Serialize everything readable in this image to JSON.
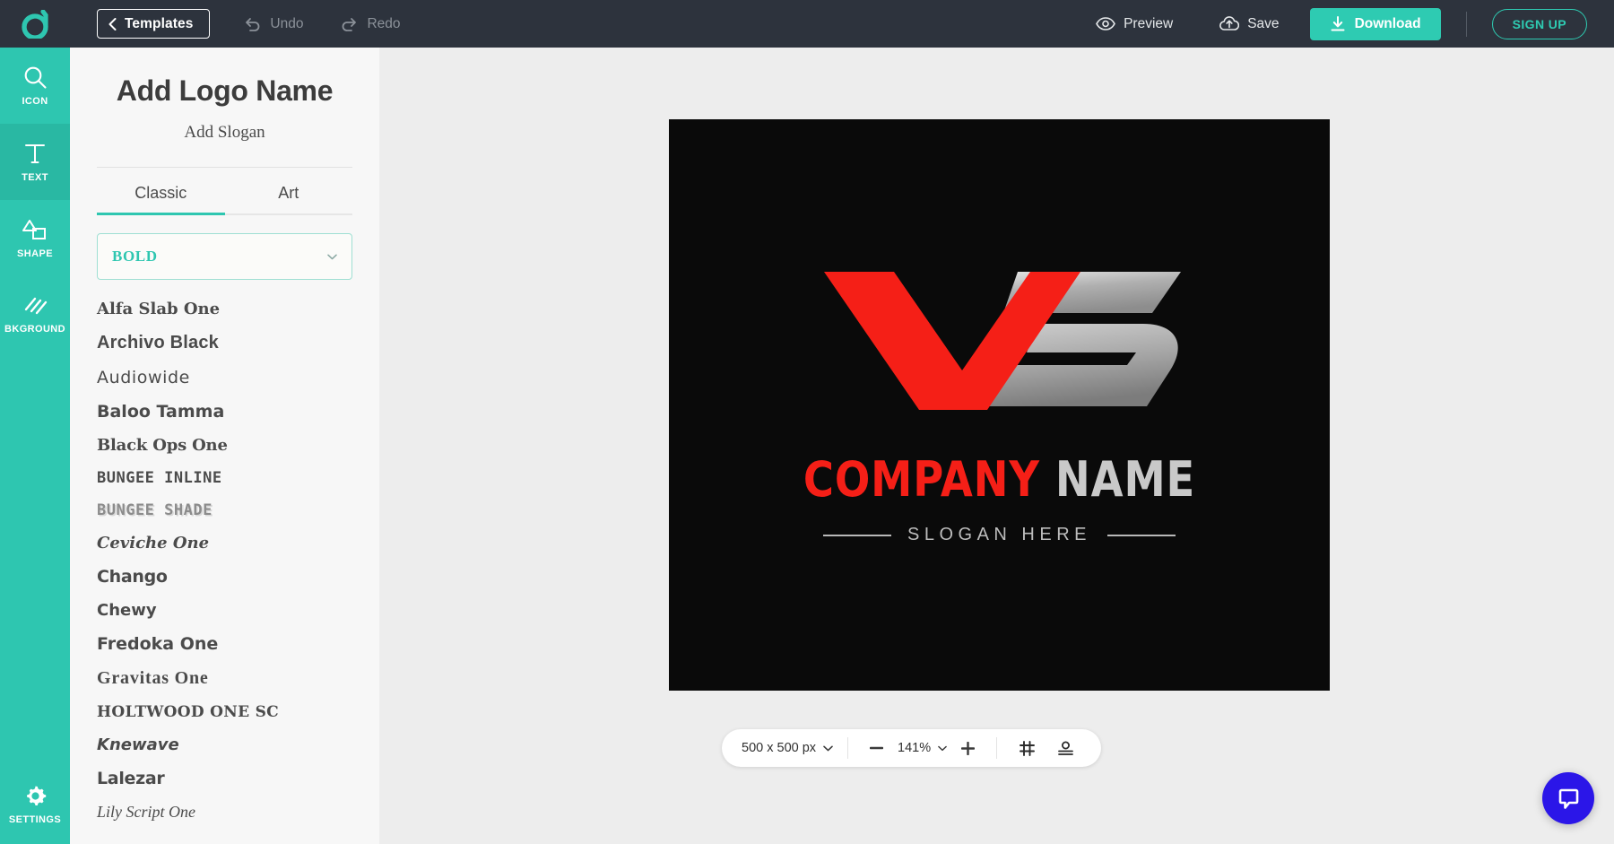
{
  "topbar": {
    "brand_icon": "designevo-logo-icon",
    "templates_label": "Templates",
    "back_icon": "chevron-left-icon",
    "undo_label": "Undo",
    "undo_icon": "undo-arrow-icon",
    "redo_label": "Redo",
    "redo_icon": "redo-arrow-icon",
    "preview_label": "Preview",
    "preview_icon": "eye-icon",
    "save_label": "Save",
    "save_icon": "cloud-upload-icon",
    "download_label": "Download",
    "download_icon": "download-icon",
    "signup_label": "SIGN UP",
    "accent_color": "#2ecbb2",
    "bar_color": "#2d333d"
  },
  "rail": {
    "active_color": "#29b8a3",
    "base_color": "#2ec6b0",
    "items": [
      {
        "label": "ICON",
        "icon": "search-icon",
        "active": false
      },
      {
        "label": "TEXT",
        "icon": "text-t-icon",
        "active": true
      },
      {
        "label": "SHAPE",
        "icon": "shapes-icon",
        "active": false
      },
      {
        "label": "BKGROUND",
        "icon": "hatch-pattern-icon",
        "active": false
      }
    ],
    "settings": {
      "label": "SETTINGS",
      "icon": "gear-icon"
    }
  },
  "panel": {
    "title": "Add Logo Name",
    "subtitle": "Add Slogan",
    "tabs": [
      {
        "label": "Classic",
        "active": true
      },
      {
        "label": "Art",
        "active": false
      }
    ],
    "style_select": {
      "value": "BOLD",
      "caret_icon": "chevron-down-icon",
      "text_color": "#2ec6b0"
    },
    "fonts": [
      {
        "name": "Alfa Slab One",
        "style": "f-slab"
      },
      {
        "name": "Archivo Black",
        "style": "f-black"
      },
      {
        "name": "Audiowide",
        "style": "f-wide"
      },
      {
        "name": "Baloo Tamma",
        "style": "f-round"
      },
      {
        "name": "Black Ops One",
        "style": "f-ops"
      },
      {
        "name": "BUNGEE INLINE",
        "style": "f-inline"
      },
      {
        "name": "BUNGEE SHADE",
        "style": "f-shade"
      },
      {
        "name": "Ceviche One",
        "style": "f-ital"
      },
      {
        "name": "Chango",
        "style": "f-fat"
      },
      {
        "name": "Chewy",
        "style": "f-chewy"
      },
      {
        "name": "Fredoka One",
        "style": "f-round"
      },
      {
        "name": "Gravitas One",
        "style": "f-grav"
      },
      {
        "name": "HOLTWOOD ONE SC",
        "style": "f-holt"
      },
      {
        "name": "Knewave",
        "style": "f-knew"
      },
      {
        "name": "Lalezar",
        "style": "f-fat"
      },
      {
        "name": "Lily Script One",
        "style": "f-lily"
      }
    ]
  },
  "canvas": {
    "background_color": "#0a0a0a",
    "mark_letters": "VS",
    "mark_red_color": "#f51f17",
    "mark_silver_color": "#c9c9c9",
    "company_word_1": "COMPANY",
    "company_word_2": "NAME",
    "slogan": "SLOGAN HERE"
  },
  "bottombar": {
    "size_value": "500 x 500 px",
    "size_caret_icon": "chevron-down-icon",
    "zoom_out_icon": "minus-icon",
    "zoom_value": "141%",
    "zoom_caret_icon": "chevron-down-icon",
    "zoom_in_icon": "plus-icon",
    "grid_icon": "grid-icon",
    "snap_icon": "align-bottom-icon"
  },
  "chat": {
    "icon": "chat-bubble-icon",
    "color": "#2b16e8"
  }
}
